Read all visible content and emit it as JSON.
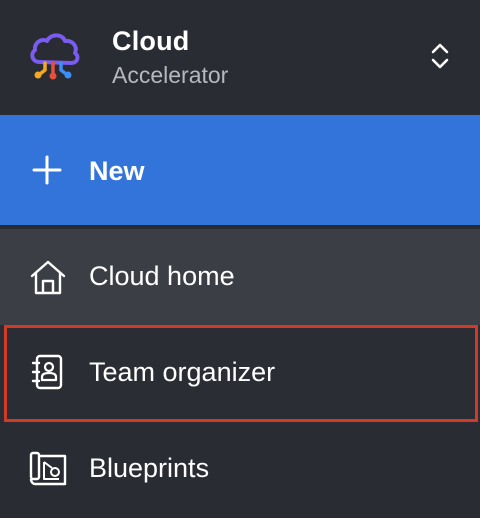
{
  "header": {
    "org_name": "Cloud",
    "org_subtitle": "Accelerator",
    "logo_icon": "cloud-circuit-logo-icon",
    "switcher_icon": "chevron-up-down-icon"
  },
  "new_button": {
    "label": "New",
    "icon": "plus-icon"
  },
  "nav": {
    "items": [
      {
        "label": "Cloud home",
        "icon": "home-icon",
        "state": "hover"
      },
      {
        "label": "Team organizer",
        "icon": "contact-book-icon",
        "state": "highlighted"
      },
      {
        "label": "Blueprints",
        "icon": "blueprint-icon",
        "state": "default"
      }
    ]
  },
  "colors": {
    "background": "#2a2c33",
    "accent": "#3374db",
    "hover": "#3b3e45",
    "highlight_border": "#d23a28"
  }
}
